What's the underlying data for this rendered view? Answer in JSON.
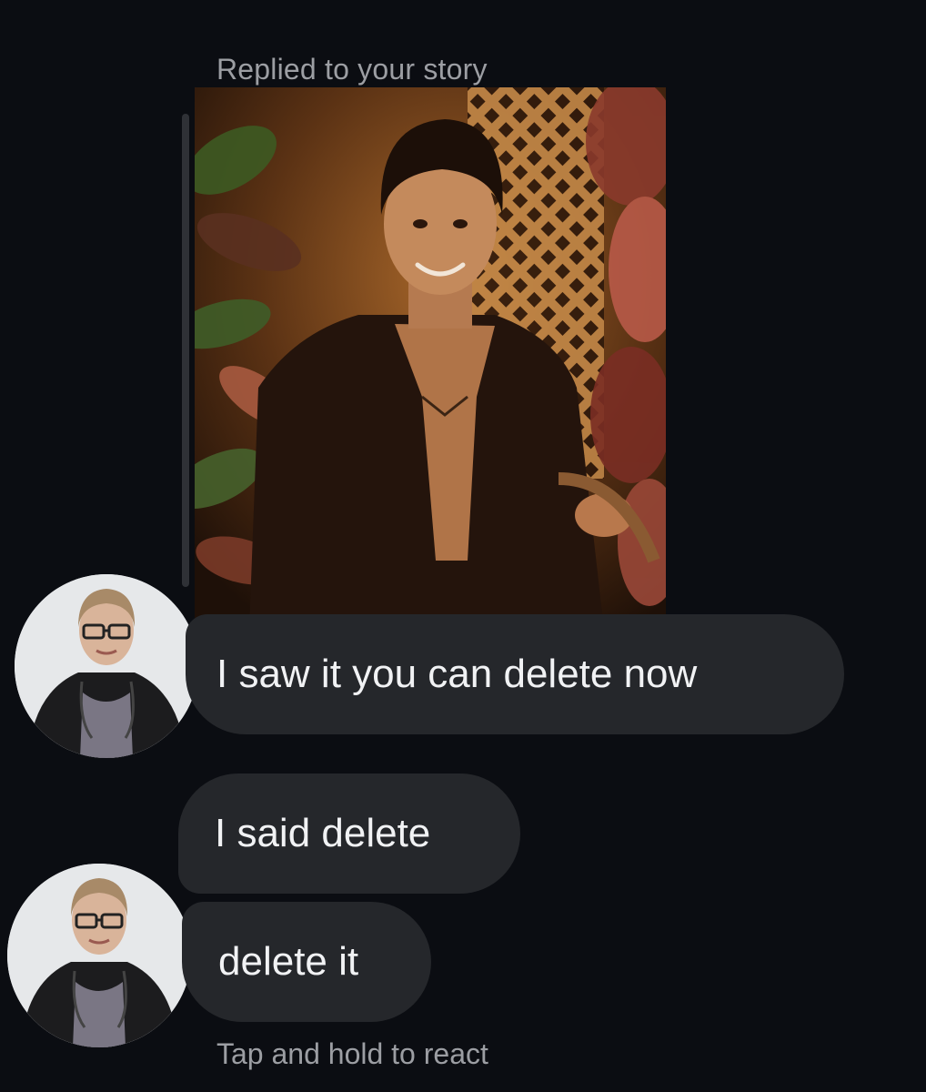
{
  "reply_context": {
    "label": "Replied to your story",
    "story_image": "story-photo-man-in-dark-jacket"
  },
  "messages": [
    {
      "text": "I saw it you can delete now",
      "has_avatar": true
    },
    {
      "text": "I said delete",
      "has_avatar": false
    },
    {
      "text": "delete it",
      "has_avatar": true
    }
  ],
  "hint": {
    "text": "Tap and hold to react"
  },
  "colors": {
    "background": "#0b0d12",
    "bubble": "#25272b",
    "bubble_text": "#f1f2f4",
    "muted_text": "#9c9ea3"
  }
}
